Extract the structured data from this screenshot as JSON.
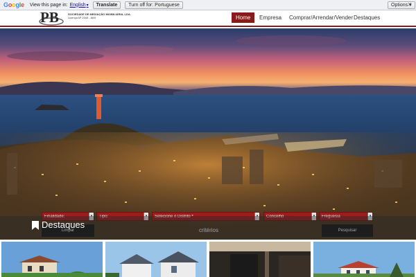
{
  "translate_bar": {
    "logo_letters": [
      "G",
      "o",
      "o",
      "g",
      "l",
      "e"
    ],
    "prompt": "View this page in:",
    "language": "English",
    "translate_label": "Translate",
    "turn_off_label": "Turn off for: Portuguese",
    "options_label": "Options",
    "options_caret": "▾",
    "close_glyph": "✕"
  },
  "header": {
    "company_name": "SOCIEDADE DE MEDIAÇÃO IMOBILIÁRIA, LDA.",
    "license": "Licença Nº 2343 - AMI",
    "nav": [
      {
        "label": "Home",
        "active": true
      },
      {
        "label": "Empresa",
        "active": false
      },
      {
        "label": "Comprar/Arrendar/Vender",
        "active": false
      },
      {
        "label": "Destaques",
        "active": false
      }
    ]
  },
  "search": {
    "fields": [
      {
        "label": "Finalidade:"
      },
      {
        "label": "Tipo:"
      },
      {
        "label": "Selecione o Distrito *"
      },
      {
        "label": "Concelho"
      },
      {
        "label": "Freguesia"
      }
    ],
    "dropdown_glyph": "▾",
    "clear_label": "Limpar",
    "criteria_label": "critérios",
    "search_label": "Pesquisar"
  },
  "destaques": {
    "title": "Destaques"
  },
  "colors": {
    "accent": "#8a1a1a",
    "form_red": "#a01c1c"
  }
}
